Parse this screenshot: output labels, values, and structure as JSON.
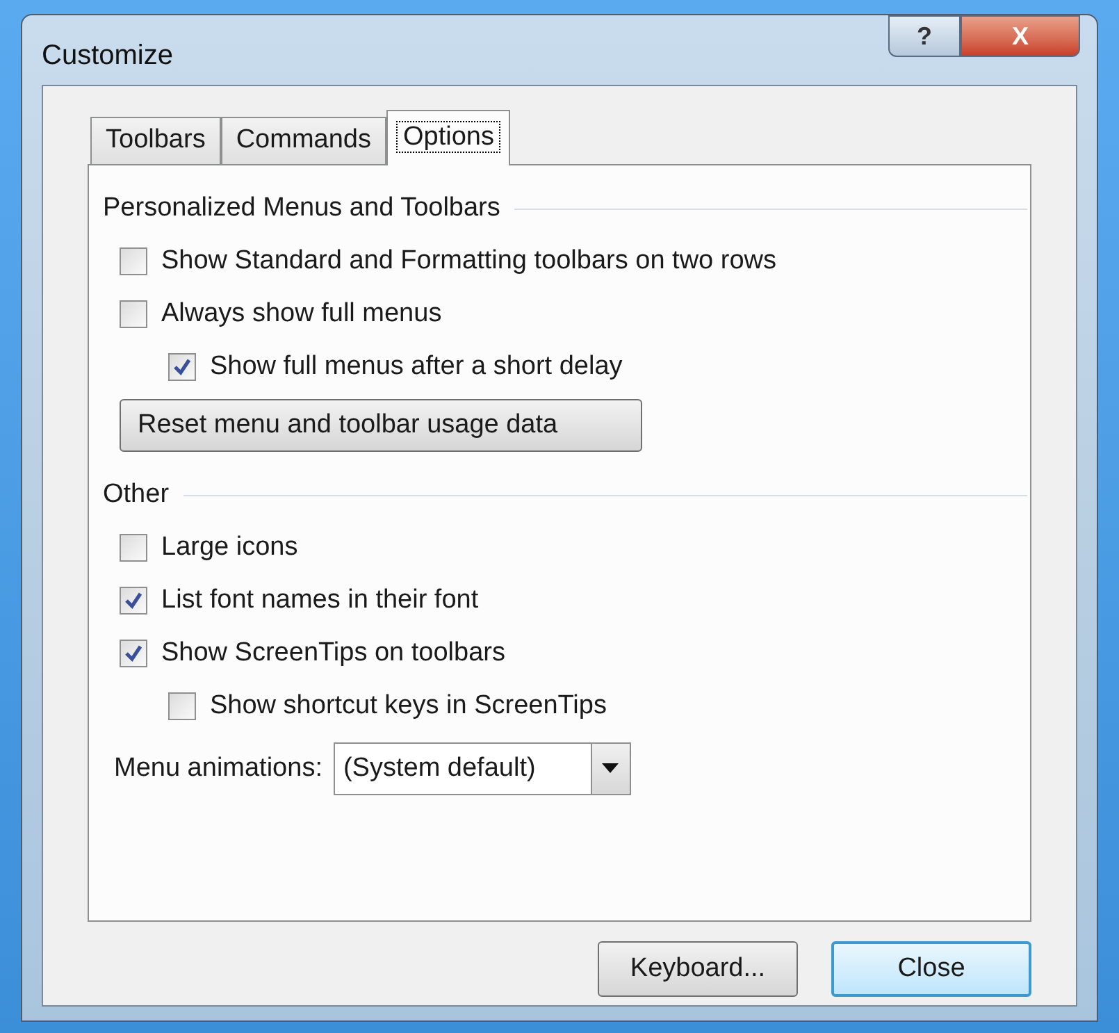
{
  "window": {
    "title": "Customize",
    "controls": [
      {
        "kind": "help",
        "label": "?"
      },
      {
        "kind": "close",
        "label": "X"
      }
    ]
  },
  "tabs": [
    {
      "label": "Toolbars",
      "selected": false
    },
    {
      "label": "Commands",
      "selected": false
    },
    {
      "label": "Options",
      "selected": true
    }
  ],
  "sections": [
    {
      "title": "Personalized Menus and Toolbars",
      "items": [
        {
          "kind": "checkbox",
          "label": "Show Standard and Formatting toolbars on two rows",
          "checked": false
        },
        {
          "kind": "checkbox",
          "label": "Always show full menus",
          "checked": false,
          "children": [
            {
              "kind": "checkbox",
              "label": "Show full menus after a short delay",
              "checked": true
            }
          ]
        },
        {
          "kind": "button",
          "label": "Reset menu and toolbar usage data"
        }
      ]
    },
    {
      "title": "Other",
      "items": [
        {
          "kind": "checkbox",
          "label": "Large icons",
          "checked": false
        },
        {
          "kind": "checkbox",
          "label": "List font names in their font",
          "checked": true
        },
        {
          "kind": "checkbox",
          "label": "Show ScreenTips on toolbars",
          "checked": true,
          "children": [
            {
              "kind": "checkbox",
              "label": "Show shortcut keys in ScreenTips",
              "checked": false
            }
          ]
        },
        {
          "kind": "select",
          "label": "Menu animations:",
          "value": "(System default)"
        }
      ]
    }
  ],
  "buttons": [
    {
      "label": "Keyboard...",
      "default": false
    },
    {
      "label": "Close",
      "default": true
    }
  ]
}
